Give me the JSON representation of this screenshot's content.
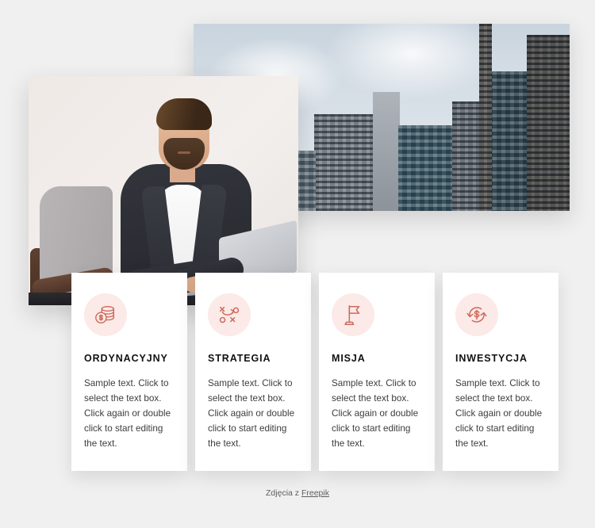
{
  "page": {
    "background_color": "#f0f0f0",
    "accent_color": "#cd6a5c",
    "icon_bg_color": "#fbeae7"
  },
  "images": [
    {
      "name": "cityscape-photo",
      "alt": "Modern glass office skyscrapers against a cloudy grey sky"
    },
    {
      "name": "businessman-photo",
      "alt": "Bearded businessman in a dark blazer and white t-shirt working on a laptop in a grey armchair"
    }
  ],
  "cards": [
    {
      "icon": "coin-stack-icon",
      "title": "ORDYNACYJNY",
      "body": "Sample text. Click to select the text box. Click again or double click to start editing the text."
    },
    {
      "icon": "strategy-tactics-icon",
      "title": "STRATEGIA",
      "body": "Sample text. Click to select the text box. Click again or double click to start editing the text."
    },
    {
      "icon": "flag-icon",
      "title": "MISJA",
      "body": "Sample text. Click to select the text box. Click again or double click to start editing the text."
    },
    {
      "icon": "money-refresh-icon",
      "title": "INWESTYCJA",
      "body": "Sample text. Click to select the text box. Click again or double click to start editing the text."
    }
  ],
  "footer": {
    "prefix": "Zdjęcia z ",
    "link_label": "Freepik"
  }
}
